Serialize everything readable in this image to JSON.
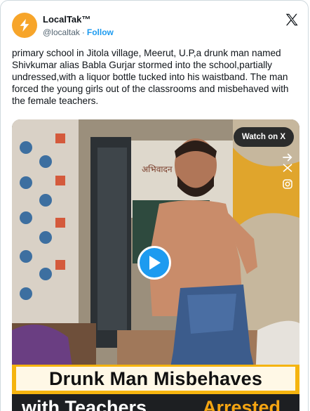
{
  "author": {
    "name": "LocalTak™",
    "handle": "@localtak",
    "separator": "·",
    "follow_label": "Follow"
  },
  "tweet": {
    "text": "primary school in Jitola village, Meerut, U.P,a drunk man named Shivkumar alias Babla Gurjar stormed into the school,partially undressed,with a liquor bottle tucked into his waistband. The man forced the young girls out of the classrooms and misbehaved with the female teachers."
  },
  "media": {
    "watch_label": "Watch on X",
    "caption_line1": "Drunk Man Misbehaves",
    "caption_line2_white": "with Teachers,",
    "caption_line2_orange": "Arrested"
  },
  "icons": {
    "avatar": "lightning-bolt-icon",
    "x_logo": "x-logo-icon",
    "play": "play-icon",
    "overlay": [
      "arrow-right-icon",
      "scissors-icon",
      "instagram-icon"
    ]
  },
  "colors": {
    "link": "#1d9bf0",
    "avatar_bg": "#f7a52a",
    "caption_bar": "#f5b40f",
    "caption_orange": "#f5a512"
  }
}
